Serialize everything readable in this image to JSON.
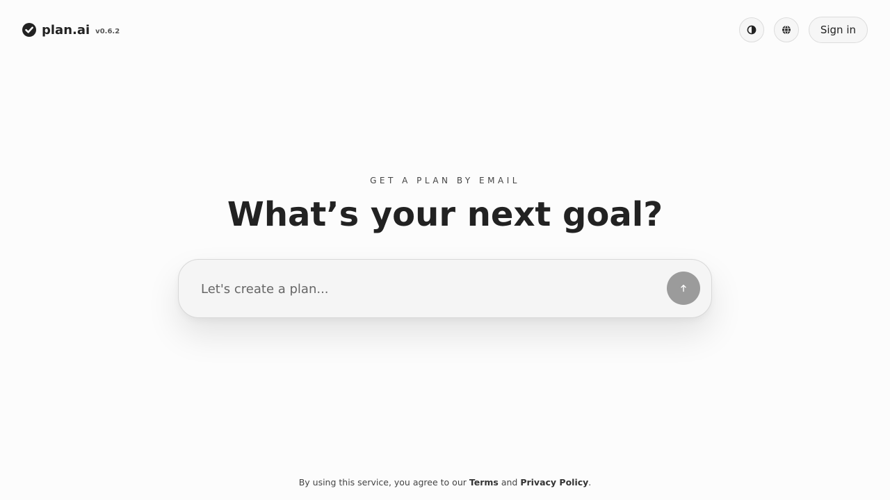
{
  "header": {
    "logo_text": "plan.ai",
    "version": "v0.6.2",
    "theme_icon": "contrast-icon",
    "language_icon": "globe-icon",
    "signin_label": "Sign in"
  },
  "hero": {
    "eyebrow": "GET A PLAN BY EMAIL",
    "headline": "What’s your next goal?"
  },
  "prompt": {
    "placeholder": "Let's create a plan...",
    "value": "",
    "send_icon": "arrow-up-icon"
  },
  "footer": {
    "prefix": "By using this service, you agree to our ",
    "terms": "Terms",
    "and": " and ",
    "privacy": "Privacy Policy",
    "suffix": "."
  },
  "colors": {
    "background": "#fcfcfc",
    "text": "#222222",
    "send_button": "#9b9b9b"
  }
}
